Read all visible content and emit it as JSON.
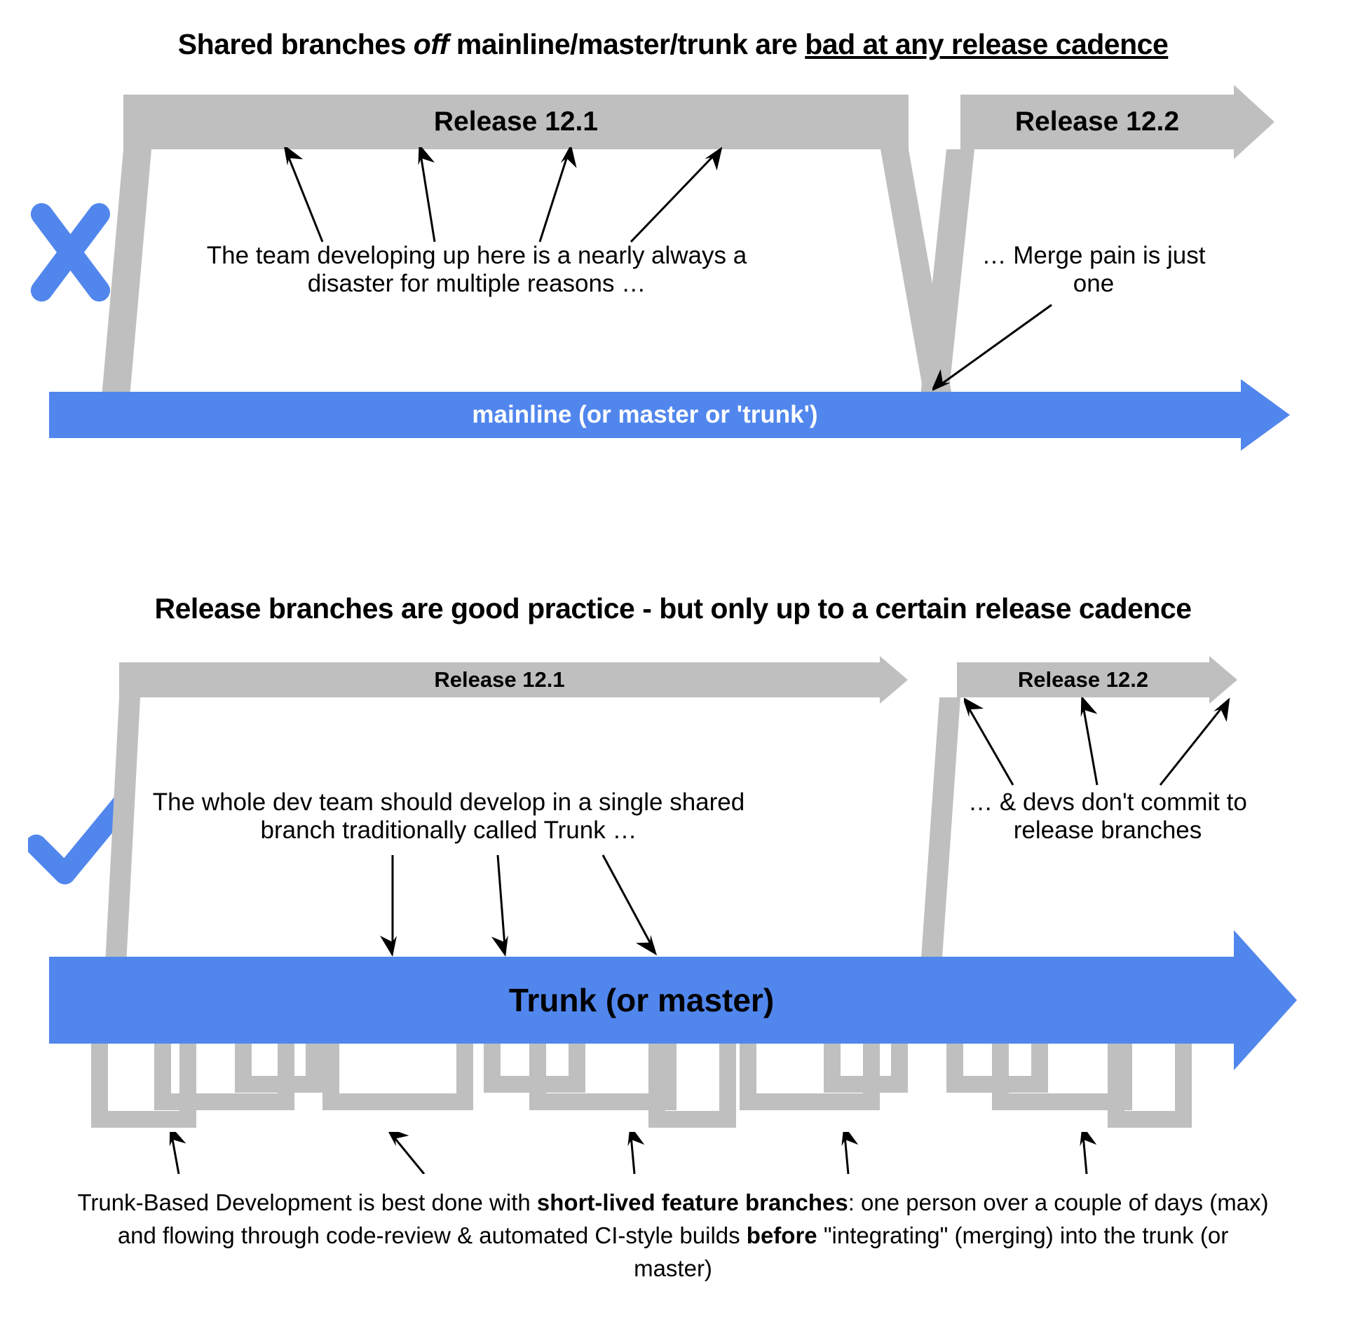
{
  "top": {
    "heading_pre": "Shared branches ",
    "heading_off": "off",
    "heading_mid": " mainline/master/trunk are ",
    "heading_bad": "bad at any release cadence",
    "release1": "Release 12.1",
    "release2": "Release 12.2",
    "annotation_main": "The team developing up here is a nearly always a disaster for multiple reasons …",
    "annotation_merge": "… Merge pain is just one",
    "mainline_label": "mainline (or master or 'trunk')"
  },
  "bottom": {
    "heading": "Release branches are good practice - but only up to a certain release cadence",
    "release1": "Release 12.1",
    "release2": "Release 12.2",
    "annotation_main": "The whole dev team should develop in a single shared branch traditionally called Trunk …",
    "annotation_right": "… & devs don't commit to release branches",
    "trunk_label": "Trunk (or master)",
    "caption_pre": "Trunk-Based Development is best done with ",
    "caption_b1": "short-lived feature branches",
    "caption_mid": ": one person over a couple of days (max) and flowing through code-review & automated CI-style builds ",
    "caption_b2": "before",
    "caption_post": " \"integrating\" (merging) into the trunk (or master)"
  },
  "colors": {
    "blue": "#5186ed",
    "grey": "#bfbfbf"
  }
}
